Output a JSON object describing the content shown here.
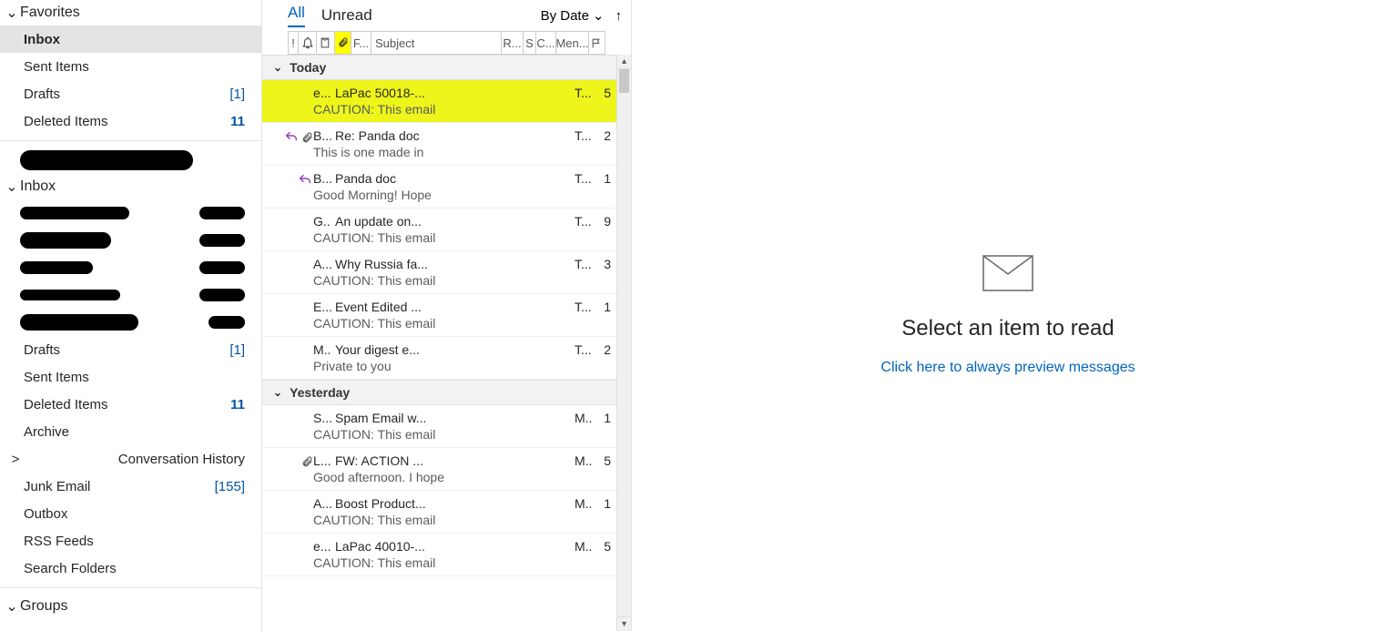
{
  "nav": {
    "favorites_label": "Favorites",
    "groups_label": "Groups",
    "favorites": [
      {
        "label": "Inbox",
        "count": "",
        "bold": false,
        "selected": true
      },
      {
        "label": "Sent Items",
        "count": "",
        "bold": false,
        "selected": false
      },
      {
        "label": "Drafts",
        "count": "[1]",
        "bold": false,
        "selected": false
      },
      {
        "label": "Deleted Items",
        "count": "11",
        "bold": true,
        "selected": false
      }
    ],
    "inbox_label": "Inbox",
    "account_items": [
      {
        "label": "Drafts",
        "count": "[1]",
        "bold": false,
        "chev": ""
      },
      {
        "label": "Sent Items",
        "count": "",
        "bold": false,
        "chev": ""
      },
      {
        "label": "Deleted Items",
        "count": "11",
        "bold": true,
        "chev": ""
      },
      {
        "label": "Archive",
        "count": "",
        "bold": false,
        "chev": ""
      },
      {
        "label": "Conversation History",
        "count": "",
        "bold": false,
        "chev": ">"
      },
      {
        "label": "Junk Email",
        "count": "[155]",
        "bold": false,
        "chev": ""
      },
      {
        "label": "Outbox",
        "count": "",
        "bold": false,
        "chev": ""
      },
      {
        "label": "RSS Feeds",
        "count": "",
        "bold": false,
        "chev": ""
      },
      {
        "label": "Search Folders",
        "count": "",
        "bold": false,
        "chev": ""
      }
    ]
  },
  "list": {
    "tab_all": "All",
    "tab_unread": "Unread",
    "sort_label": "By Date",
    "filter_from": "F...",
    "filter_subject": "Subject",
    "filter_r": "R...",
    "filter_s": "S",
    "filter_c": "C...",
    "filter_men": "Men...",
    "groups": [
      {
        "label": "Today",
        "msgs": [
          {
            "from": "e...",
            "subj": "LaPac 50018-...",
            "date": "T...",
            "num": "5",
            "preview": "CAUTION: This email",
            "reply": false,
            "attach": false,
            "highlight": true
          },
          {
            "from": "B...",
            "subj": "Re: Panda doc",
            "date": "T...",
            "num": "2",
            "preview": "This is one made in",
            "reply": true,
            "attach": true,
            "highlight": false
          },
          {
            "from": "B...",
            "subj": "Panda doc",
            "date": "T...",
            "num": "1",
            "preview": "Good Morning!  Hope",
            "reply": true,
            "attach": false,
            "highlight": false
          },
          {
            "from": "G...",
            "subj": "An update on...",
            "date": "T...",
            "num": "9",
            "preview": "CAUTION: This email",
            "reply": false,
            "attach": false,
            "highlight": false
          },
          {
            "from": "A...",
            "subj": "Why Russia fa...",
            "date": "T...",
            "num": "3",
            "preview": "CAUTION: This email",
            "reply": false,
            "attach": false,
            "highlight": false
          },
          {
            "from": "E...",
            "subj": "Event Edited ...",
            "date": "T...",
            "num": "1",
            "preview": "CAUTION: This email",
            "reply": false,
            "attach": false,
            "highlight": false
          },
          {
            "from": "M...",
            "subj": "Your digest e...",
            "date": "T...",
            "num": "2",
            "preview": "Private to you",
            "reply": false,
            "attach": false,
            "highlight": false
          }
        ]
      },
      {
        "label": "Yesterday",
        "msgs": [
          {
            "from": "S...",
            "subj": "Spam Email w...",
            "date": "M..",
            "num": "1",
            "preview": "CAUTION: This email",
            "reply": false,
            "attach": false,
            "highlight": false
          },
          {
            "from": "L...",
            "subj": "FW: ACTION ...",
            "date": "M..",
            "num": "5",
            "preview": "Good afternoon.  I hope",
            "reply": false,
            "attach": true,
            "highlight": false
          },
          {
            "from": "A...",
            "subj": "Boost Product...",
            "date": "M..",
            "num": "1",
            "preview": "CAUTION: This email",
            "reply": false,
            "attach": false,
            "highlight": false
          },
          {
            "from": "e...",
            "subj": "LaPac 40010-...",
            "date": "M..",
            "num": "5",
            "preview": "CAUTION: This email",
            "reply": false,
            "attach": false,
            "highlight": false
          }
        ]
      }
    ]
  },
  "reader": {
    "title": "Select an item to read",
    "link": "Click here to always preview messages"
  }
}
